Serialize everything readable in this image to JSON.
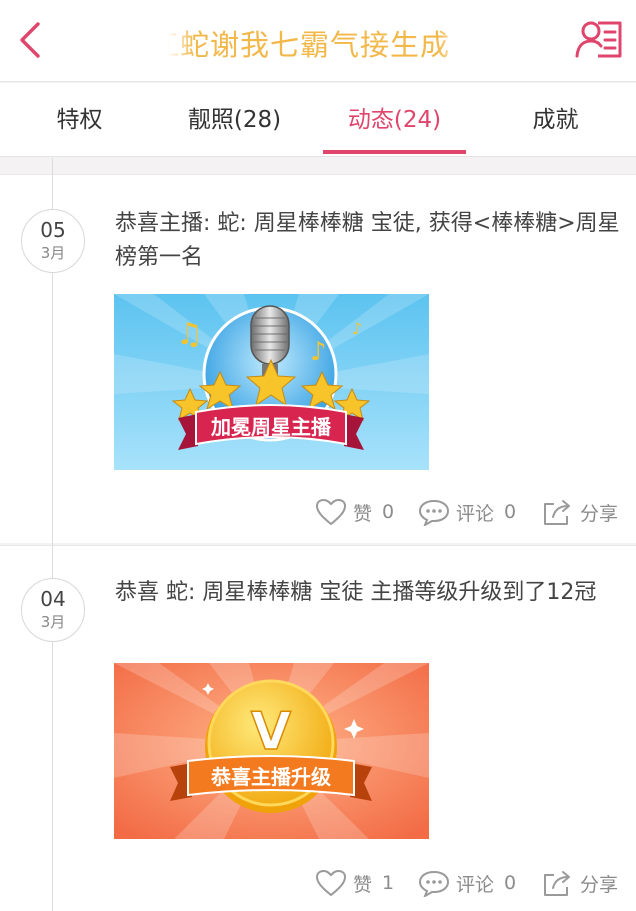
{
  "header": {
    "title": "江蛇谢我七霸气接生成",
    "back_icon": "chevron-left-icon",
    "profile_icon": "profile-card-icon",
    "accent": "#e0456c",
    "title_color": "#f2b84a"
  },
  "tabs": [
    {
      "label": "特权",
      "active": false
    },
    {
      "label": "靓照(28)",
      "active": false
    },
    {
      "label": "动态(24)",
      "active": true
    },
    {
      "label": "成就",
      "active": false
    }
  ],
  "feed": [
    {
      "day": "05",
      "month": "3月",
      "text": "恭喜主播: 蛇: 周星棒棒糖 宝徒, 获得<棒棒糖>周星榜第一名",
      "image_caption": "加冕周星主播",
      "like_label": "赞",
      "like_count": "0",
      "comment_label": "评论",
      "comment_count": "0",
      "share_label": "分享"
    },
    {
      "day": "04",
      "month": "3月",
      "text": "恭喜 蛇: 周星棒棒糖 宝徒 主播等级升级到了12冠",
      "image_caption": "恭喜主播升级",
      "image_badge": "V",
      "like_label": "赞",
      "like_count": "1",
      "comment_label": "评论",
      "comment_count": "0",
      "share_label": "分享"
    }
  ]
}
